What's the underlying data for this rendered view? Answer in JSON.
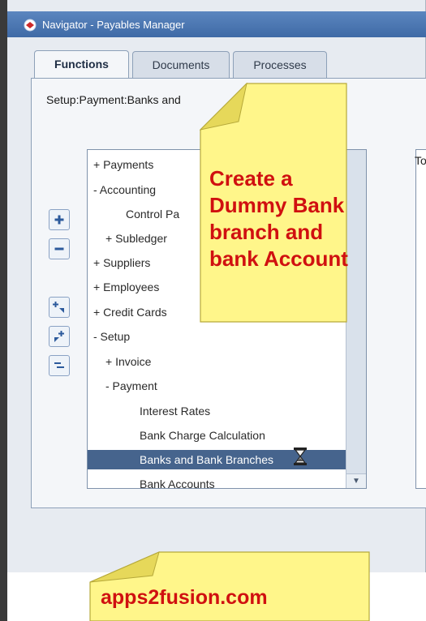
{
  "window": {
    "title": "Navigator - Payables Manager"
  },
  "tabs": [
    {
      "label": "Functions",
      "active": true
    },
    {
      "label": "Documents",
      "active": false
    },
    {
      "label": "Processes",
      "active": false
    }
  ],
  "breadcrumb": "Setup:Payment:Banks and",
  "right_panel_label": "To",
  "tree": [
    {
      "label": "+ Payments",
      "selected": false
    },
    {
      "label": "- Accounting",
      "selected": false
    },
    {
      "label": "Control Pa",
      "selected": false
    },
    {
      "label": "+ Subledger",
      "selected": false
    },
    {
      "label": "+ Suppliers",
      "selected": false
    },
    {
      "label": "+ Employees",
      "selected": false
    },
    {
      "label": "+ Credit Cards",
      "selected": false
    },
    {
      "label": "- Setup",
      "selected": false
    },
    {
      "label": "+ Invoice",
      "selected": false
    },
    {
      "label": "- Payment",
      "selected": false
    },
    {
      "label": "Interest Rates",
      "selected": false
    },
    {
      "label": "Bank Charge Calculation",
      "selected": false
    },
    {
      "label": "Banks and Bank Branches",
      "selected": true
    },
    {
      "label": "Bank Accounts",
      "selected": false
    }
  ],
  "side_buttons": [
    {
      "name": "expand-button",
      "icon": "plus-icon"
    },
    {
      "name": "collapse-button",
      "icon": "minus-icon"
    },
    {
      "name": "expand-branch-button",
      "icon": "expand-branch-icon"
    },
    {
      "name": "expand-all-button",
      "icon": "expand-all-icon"
    },
    {
      "name": "collapse-all-button",
      "icon": "collapse-all-icon"
    }
  ],
  "notes": {
    "main": [
      "Create a",
      "Dummy Bank",
      "branch and",
      "bank Account"
    ],
    "footer": "apps2fusion.com"
  },
  "colors": {
    "titlebar": "#4a76b3",
    "selection": "#46648d",
    "note_bg": "#fff68a",
    "note_text": "#d01010"
  }
}
